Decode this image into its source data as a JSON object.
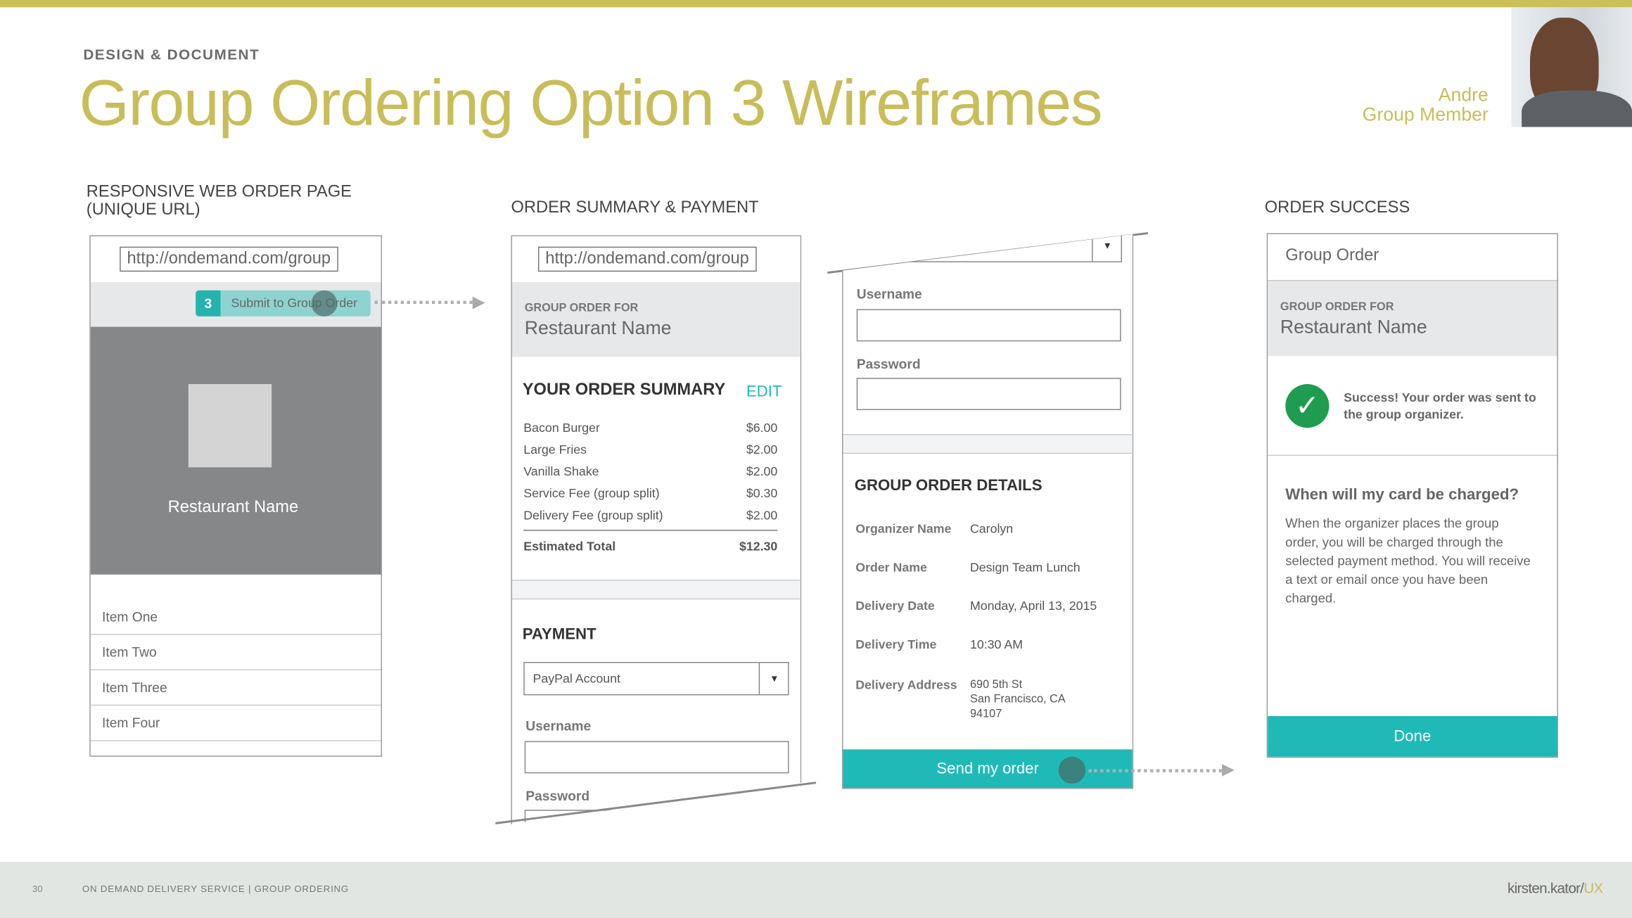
{
  "header": {
    "kicker": "DESIGN & DOCUMENT",
    "title": "Group Ordering Option 3 Wireframes",
    "persona_name": "Andre",
    "persona_role": "Group Member"
  },
  "colors": {
    "accent": "#c9bd5a",
    "teal": "#1fbab7"
  },
  "sections": {
    "web": "RESPONSIVE WEB ORDER PAGE",
    "web2": "(UNIQUE URL)",
    "summary": "ORDER SUMMARY & PAYMENT",
    "success": "ORDER SUCCESS"
  },
  "web_page": {
    "url": "http://ondemand.com/group",
    "badge": "3",
    "submit": "Submit to Group Order",
    "restaurant": "Restaurant Name",
    "items": [
      "Item One",
      "Item Two",
      "Item Three",
      "Item Four"
    ]
  },
  "summary": {
    "url": "http://ondemand.com/group",
    "group_for": "GROUP ORDER FOR",
    "restaurant": "Restaurant Name",
    "title": "YOUR ORDER SUMMARY",
    "edit": "EDIT",
    "lines": [
      {
        "name": "Bacon Burger",
        "price": "$6.00"
      },
      {
        "name": "Large Fries",
        "price": "$2.00"
      },
      {
        "name": "Vanilla Shake",
        "price": "$2.00"
      },
      {
        "name": "Service Fee (group split)",
        "price": "$0.30"
      },
      {
        "name": "Delivery Fee (group split)",
        "price": "$2.00"
      }
    ],
    "total_label": "Estimated Total",
    "total": "$12.30",
    "payment": "PAYMENT",
    "payment_method": "PayPal Account",
    "username": "Username",
    "password": "Password"
  },
  "details": {
    "username": "Username",
    "password": "Password",
    "title": "GROUP ORDER DETAILS",
    "rows": [
      {
        "k": "Organizer Name",
        "v": "Carolyn"
      },
      {
        "k": "Order Name",
        "v": "Design Team Lunch"
      },
      {
        "k": "Delivery Date",
        "v": "Monday, April 13, 2015"
      },
      {
        "k": "Delivery Time",
        "v": "10:30 AM"
      },
      {
        "k": "Delivery Address",
        "v": "690 5th St\nSan Francisco, CA\n94107"
      }
    ],
    "send": "Send my order"
  },
  "success": {
    "header": "Group Order",
    "group_for": "GROUP ORDER FOR",
    "restaurant": "Restaurant Name",
    "message": "Success! Your order was sent to the group organizer.",
    "question": "When will my card be charged?",
    "answer": "When the organizer places the group order, you will be charged through the selected payment method. You will receive a text or email once you have been charged.",
    "done": "Done"
  },
  "footer": {
    "page": "30",
    "caption": "ON DEMAND DELIVERY SERVICE | GROUP ORDERING",
    "logo": "kirsten.kator/",
    "logo_ux": "UX"
  }
}
